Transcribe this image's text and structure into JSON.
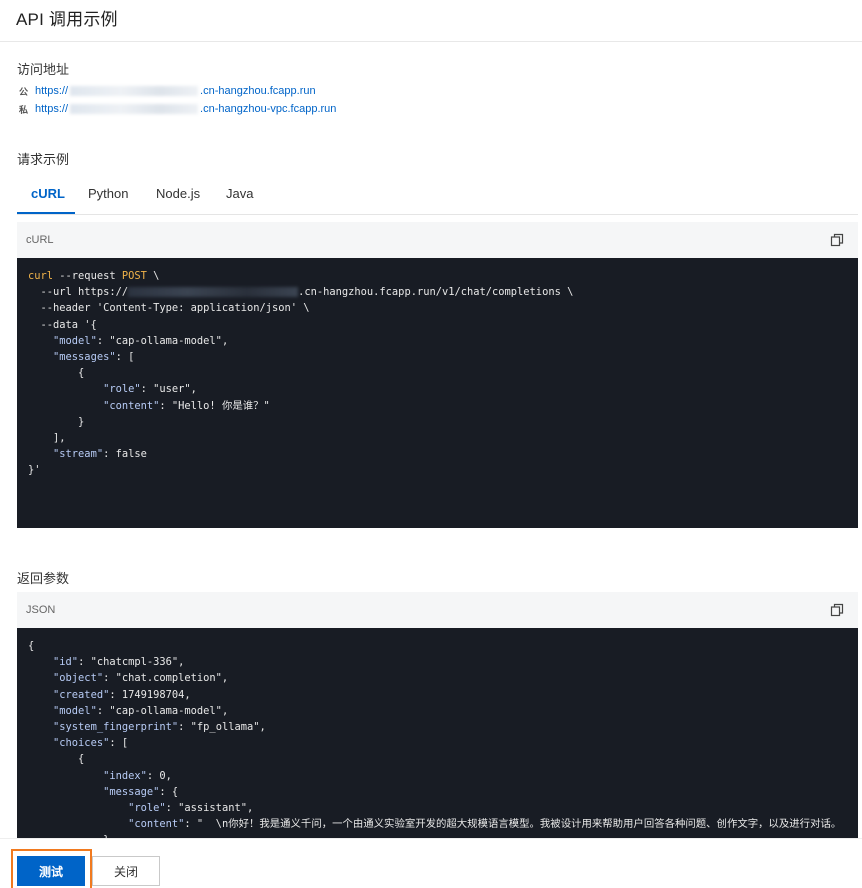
{
  "header": {
    "title": "API 调用示例"
  },
  "address": {
    "label": "访问地址",
    "public_badge": "公",
    "private_badge": "私",
    "public_prefix": "https://",
    "public_suffix": ".cn-hangzhou.fcapp.run",
    "private_prefix": "https://",
    "private_suffix": ".cn-hangzhou-vpc.fcapp.run"
  },
  "request": {
    "label": "请求示例",
    "tabs": [
      "cURL",
      "Python",
      "Node.js",
      "Java"
    ],
    "active_tab": "cURL",
    "code_lang": "cURL",
    "lines": {
      "l1_cmd": "curl",
      "l1_rest": " --request ",
      "l1_method": "POST",
      "l1_end": " \\",
      "l2_a": "  --url https://",
      "l2_b": ".cn-hangzhou.fcapp.run/v1/chat/completions \\",
      "l3": "  --header 'Content-Type: application/json' \\",
      "l4": "  --data '{",
      "l5_k": "\"model\"",
      "l5_v": ": \"cap-ollama-model\",",
      "l6_k": "\"messages\"",
      "l6_v": ": [",
      "l7": "        {",
      "l8_k": "\"role\"",
      "l8_v": ": \"user\",",
      "l9_k": "\"content\"",
      "l9_v": ": \"Hello! 你是谁？\"",
      "l10": "        }",
      "l11": "    ],",
      "l12_k": "\"stream\"",
      "l12_v": ": false",
      "l13": "}'"
    }
  },
  "response": {
    "label": "返回参数",
    "code_lang": "JSON",
    "lines": {
      "r1": "{",
      "r2_k": "\"id\"",
      "r2_v": ": \"chatcmpl-336\",",
      "r3_k": "\"object\"",
      "r3_v": ": \"chat.completion\",",
      "r4_k": "\"created\"",
      "r4_v": ": 1749198704,",
      "r5_k": "\"model\"",
      "r5_v": ": \"cap-ollama-model\",",
      "r6_k": "\"system_fingerprint\"",
      "r6_v": ": \"fp_ollama\",",
      "r7_k": "\"choices\"",
      "r7_v": ": [",
      "r8": "        {",
      "r9_k": "\"index\"",
      "r9_v": ": 0,",
      "r10_k": "\"message\"",
      "r10_v": ": {",
      "r11_k": "\"role\"",
      "r11_v": ": \"assistant\",",
      "r12_k": "\"content\"",
      "r12_v": ": \"  \\n你好！我是通义千问，一个由通义实验室开发的超大规模语言模型。我被设计用来帮助用户回答各种问题、创作文字，以及进行对话。",
      "r13": "            }"
    }
  },
  "footer": {
    "test_label": "测试",
    "close_label": "关闭"
  },
  "colors": {
    "accent": "#0064c8",
    "focus_ring": "#f17a1f",
    "code_bg": "#181c24"
  },
  "icons": {
    "copy": "copy-icon"
  }
}
